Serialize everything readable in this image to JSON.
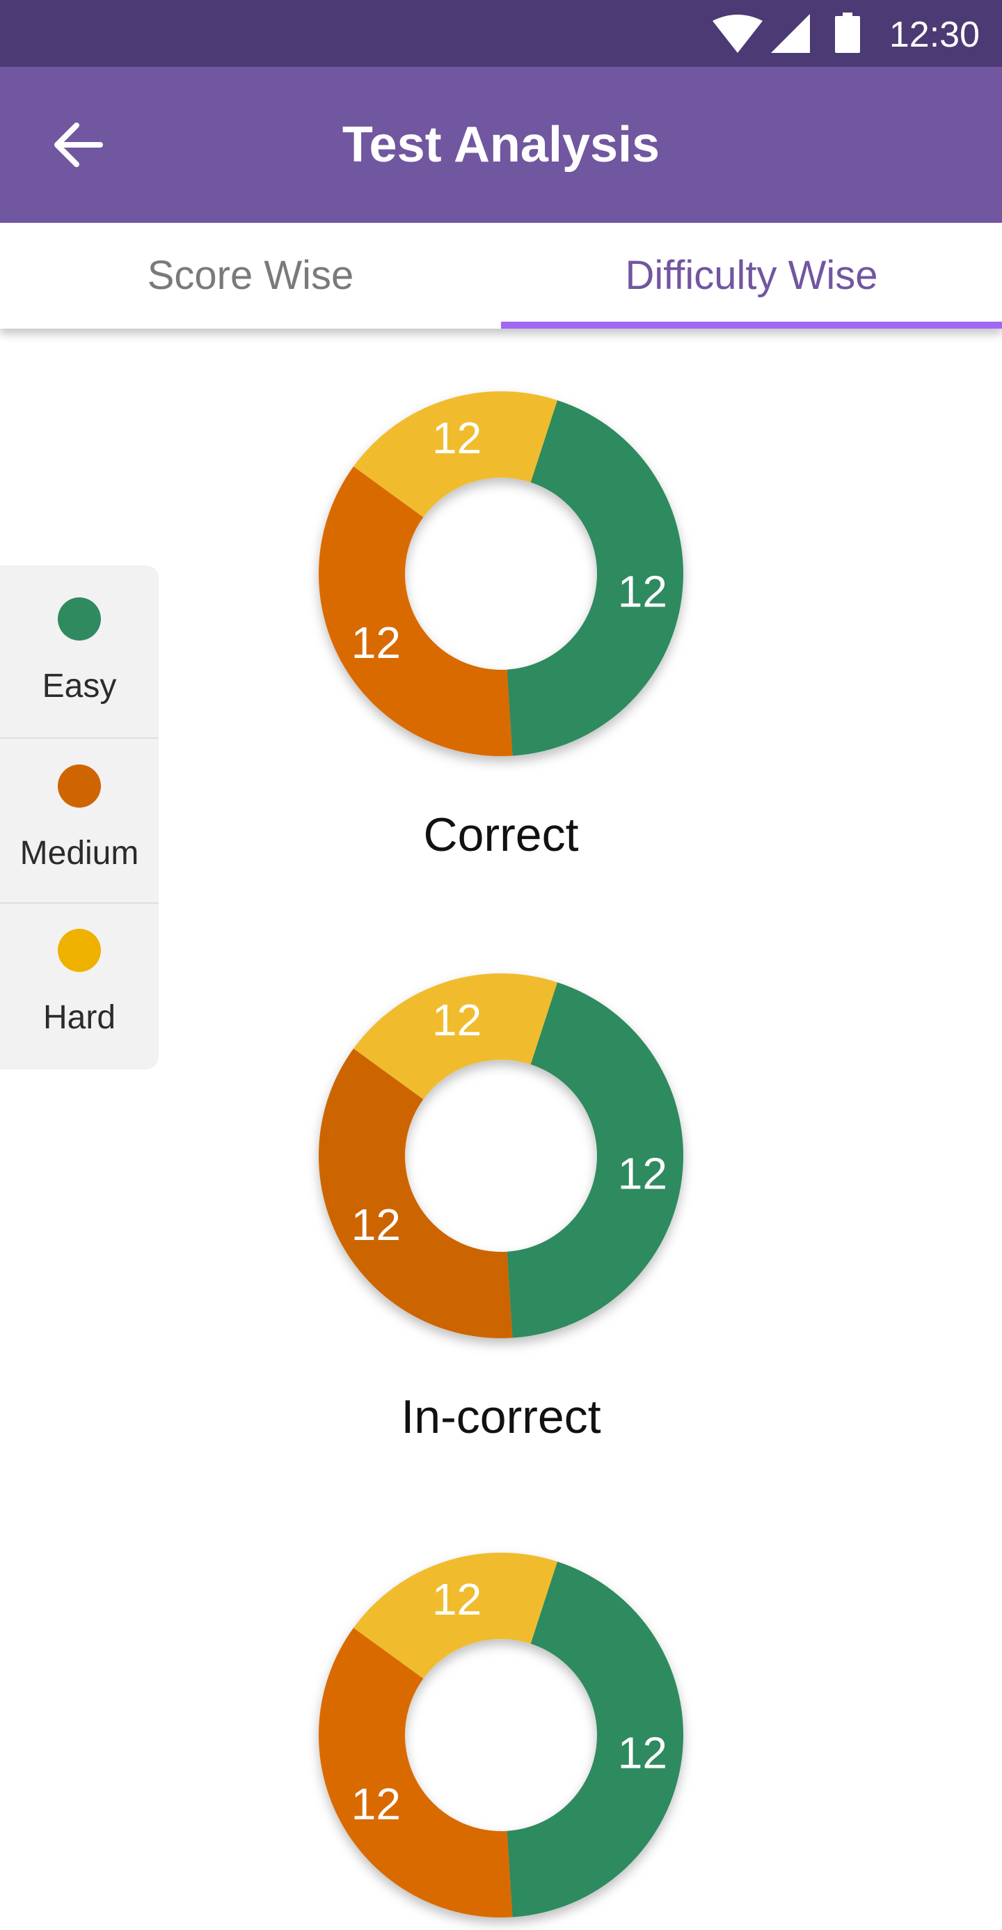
{
  "status_bar": {
    "time": "12:30"
  },
  "app_bar": {
    "title": "Test Analysis"
  },
  "tabs": [
    {
      "label": "Score Wise",
      "selected": false
    },
    {
      "label": "Difficulty Wise",
      "selected": true
    }
  ],
  "legend": [
    {
      "label": "Easy",
      "color": "#2f8a5f"
    },
    {
      "label": "Medium",
      "color": "#cf6500"
    },
    {
      "label": "Hard",
      "color": "#efb100"
    }
  ],
  "charts": [
    {
      "caption": "Correct",
      "segments": [
        {
          "category": "Easy",
          "value": 12,
          "fraction": 0.44,
          "color": "#2f8a5f"
        },
        {
          "category": "Medium",
          "value": 12,
          "fraction": 0.36,
          "color": "#d96a00"
        },
        {
          "category": "Hard",
          "value": 12,
          "fraction": 0.2,
          "color": "#f0bc2e"
        }
      ]
    },
    {
      "caption": "In-correct",
      "segments": [
        {
          "category": "Easy",
          "value": 12,
          "fraction": 0.44,
          "color": "#2f8a5f"
        },
        {
          "category": "Medium",
          "value": 12,
          "fraction": 0.36,
          "color": "#cc6500"
        },
        {
          "category": "Hard",
          "value": 12,
          "fraction": 0.2,
          "color": "#f0bc2e"
        }
      ]
    },
    {
      "caption": "",
      "segments": [
        {
          "category": "Easy",
          "value": 12,
          "fraction": 0.44,
          "color": "#2f8a5f"
        },
        {
          "category": "Medium",
          "value": 12,
          "fraction": 0.36,
          "color": "#d96a00"
        },
        {
          "category": "Hard",
          "value": 12,
          "fraction": 0.2,
          "color": "#f0bc2e"
        }
      ]
    }
  ]
}
